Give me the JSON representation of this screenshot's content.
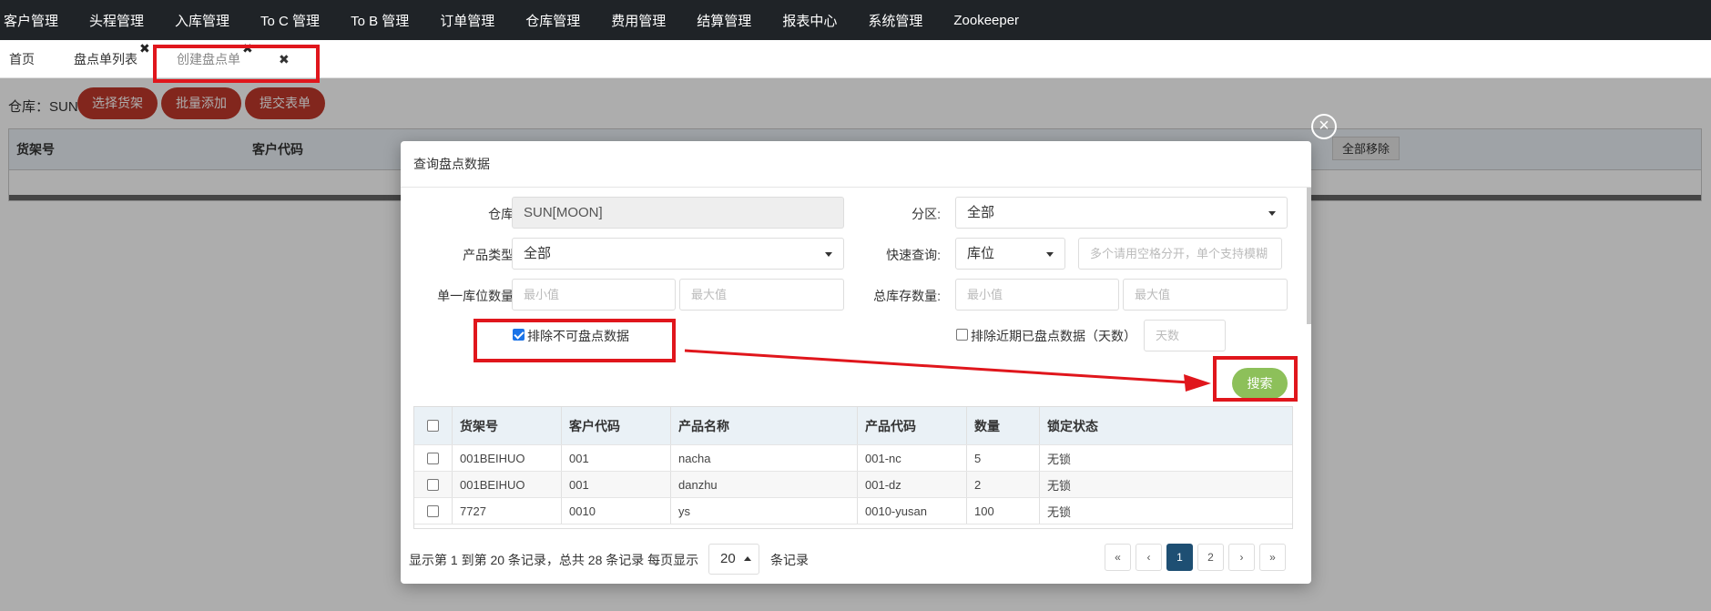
{
  "topnav": {
    "items": [
      "客户管理",
      "头程管理",
      "入库管理",
      "To C 管理",
      "To B 管理",
      "订单管理",
      "仓库管理",
      "费用管理",
      "结算管理",
      "报表中心",
      "系统管理",
      "Zookeeper"
    ]
  },
  "tabs": {
    "home": "首页",
    "list": "盘点单列表",
    "create": "创建盘点单",
    "close_icon": "✖"
  },
  "page": {
    "warehouse_label": "仓库：SUN",
    "buttons": [
      "选择货架",
      "批量添加",
      "提交表单"
    ],
    "table_headers": [
      "货架号",
      "客户代码"
    ],
    "remove_all": "全部移除"
  },
  "modal": {
    "title": "查询盘点数据",
    "close_icon": "×",
    "form": {
      "warehouse_label": "仓库:",
      "warehouse_value": "SUN[MOON]",
      "zone_label": "分区:",
      "zone_value": "全部",
      "product_type_label": "产品类型:",
      "product_type_value": "全部",
      "quick_query_label": "快速查询:",
      "quick_query_value": "库位",
      "quick_query_placeholder": "多个请用空格分开，单个支持模糊",
      "single_qty_label": "单一库位数量:",
      "total_qty_label": "总库存数量:",
      "min_placeholder": "最小值",
      "max_placeholder": "最大值",
      "exclude_uncountable": "排除不可盘点数据",
      "exclude_recent": "排除近期已盘点数据（天数）",
      "days_placeholder": "天数",
      "search": "搜索"
    },
    "table": {
      "headers": [
        "货架号",
        "客户代码",
        "产品名称",
        "产品代码",
        "数量",
        "锁定状态"
      ],
      "rows": [
        [
          "001BEIHUO",
          "001",
          "nacha",
          "001-nc",
          "5",
          "无锁"
        ],
        [
          "001BEIHUO",
          "001",
          "danzhu",
          "001-dz",
          "2",
          "无锁"
        ],
        [
          "7727",
          "0010",
          "ys",
          "0010-yusan",
          "100",
          "无锁"
        ]
      ]
    },
    "footer": {
      "summary": "显示第 1 到第 20 条记录，总共 28 条记录 每页显示",
      "page_size": "20",
      "suffix": "条记录",
      "pager": [
        "«",
        "‹",
        "1",
        "2",
        "›",
        "»"
      ]
    }
  },
  "colors": {
    "nav_bg": "#1f2327",
    "red_button": "#c0392b",
    "search_button": "#8dc05a",
    "active_page": "#1e4f73",
    "annotation": "#e0161c"
  }
}
